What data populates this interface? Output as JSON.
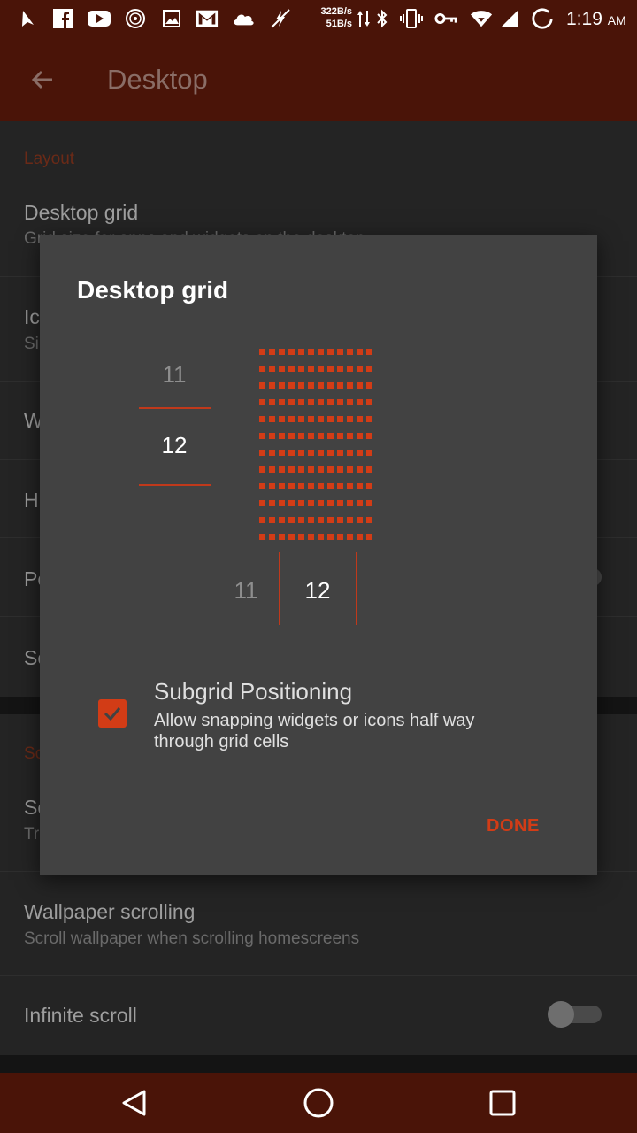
{
  "status_bar": {
    "icons_left": [
      "navigation-icon",
      "facebook-icon",
      "youtube-icon",
      "music-disc-icon",
      "image-icon",
      "gmail-icon",
      "cloud-icon",
      "no-entry-bolt-icon"
    ],
    "speed_up": "322B/s",
    "speed_down": "51B/s",
    "icons_right": [
      "data-arrows-icon",
      "bluetooth-icon",
      "vibrate-icon",
      "vpn-key-icon",
      "wifi-icon",
      "signal-icon",
      "battery-charging-icon"
    ],
    "time": "1:19",
    "ampm": "AM"
  },
  "toolbar": {
    "title": "Desktop"
  },
  "background_list": {
    "section_layout": "Layout",
    "desktop_grid_title": "Desktop grid",
    "desktop_grid_sub": "Grid size for apps and widgets on the desktop",
    "row2_title": "Icon",
    "row2_sub": "Si",
    "row3_title": "W",
    "row4_title": "H",
    "row5_title": "Po",
    "row6_title": "Se",
    "section2": "Sc",
    "row7_title": "Sc",
    "row7_sub": "Tr",
    "wallpaper_title": "Wallpaper scrolling",
    "wallpaper_sub": "Scroll wallpaper when scrolling homescreens",
    "infinite_title": "Infinite scroll"
  },
  "dialog": {
    "title": "Desktop grid",
    "rows_prev": "11",
    "rows_value": "12",
    "cols_prev": "11",
    "cols_value": "12",
    "grid_rows": 12,
    "grid_cols": 12,
    "subgrid_title": "Subgrid Positioning",
    "subgrid_desc": "Allow snapping widgets or icons half way through grid cells",
    "subgrid_checked": true,
    "done_label": "DONE"
  },
  "colors": {
    "accent": "#d23c16",
    "bar": "#4a1408",
    "dialog": "#424242"
  },
  "nav_bar": {
    "icons": [
      "back-triangle-icon",
      "home-circle-icon",
      "recents-square-icon"
    ]
  }
}
